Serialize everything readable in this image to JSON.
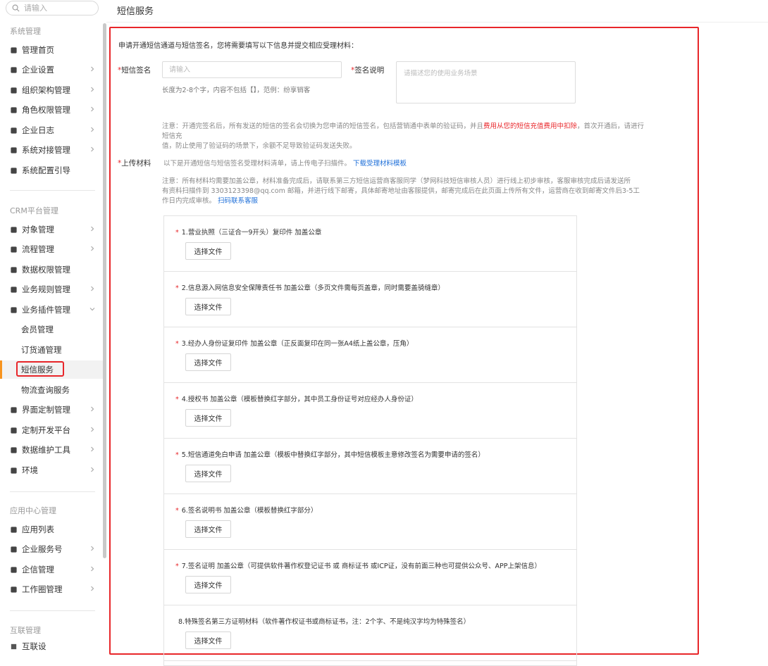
{
  "sidebar": {
    "search_placeholder": "请输入",
    "sections": [
      {
        "title": "系统管理"
      },
      {
        "title": "CRM平台管理"
      },
      {
        "title": "应用中心管理"
      },
      {
        "title": "互联管理"
      }
    ],
    "system_items": [
      {
        "label": "管理首页",
        "icon": "home-icon"
      },
      {
        "label": "企业设置",
        "icon": "building-icon"
      },
      {
        "label": "组织架构管理",
        "icon": "org-chart-icon"
      },
      {
        "label": "角色权限管理",
        "icon": "id-card-icon"
      },
      {
        "label": "企业日志",
        "icon": "log-icon"
      },
      {
        "label": "系统对接管理",
        "icon": "link-icon"
      },
      {
        "label": "系统配置引导",
        "icon": "config-icon"
      }
    ],
    "crm_items": [
      {
        "label": "对象管理",
        "icon": "user-object-icon"
      },
      {
        "label": "流程管理",
        "icon": "flow-icon"
      },
      {
        "label": "数据权限管理",
        "icon": "lock-icon"
      },
      {
        "label": "业务规则管理",
        "icon": "wrench-icon"
      },
      {
        "label": "业务插件管理",
        "icon": "puzzle-icon"
      }
    ],
    "plugin_sub_items": [
      {
        "label": "会员管理"
      },
      {
        "label": "订货通管理"
      },
      {
        "label": "短信服务"
      },
      {
        "label": "物流查询服务"
      }
    ],
    "crm_items_after": [
      {
        "label": "界面定制管理",
        "icon": "palette-icon"
      },
      {
        "label": "定制开发平台",
        "icon": "monitor-icon"
      },
      {
        "label": "数据维护工具",
        "icon": "database-icon"
      },
      {
        "label": "环境",
        "icon": "pulse-icon"
      }
    ],
    "app_items": [
      {
        "label": "应用列表",
        "icon": "grid-icon"
      },
      {
        "label": "企业服务号",
        "icon": "desktop-icon"
      },
      {
        "label": "企信管理",
        "icon": "chat-icon"
      },
      {
        "label": "工作圈管理",
        "icon": "edit-icon"
      }
    ],
    "partial_item": {
      "label": "互联设"
    }
  },
  "page": {
    "title": "短信服务",
    "intro": "申请开通短信通道与短信签名，您将需要填写以下信息并提交相应受理材料：",
    "signature": {
      "label": "短信签名",
      "placeholder": "请输入",
      "hint": "长度为2-8个字，内容不包括【】，范例：纷享销客"
    },
    "signature_desc": {
      "label": "签名说明",
      "placeholder": "请描述您的使用业务场景"
    },
    "notice_prefix": "注意：开通完签名后，所有发送的短信的签名会切换为您申请的短信签名，包括营销通中表单的验证码，并且",
    "notice_red": "费用从您的短信充值费用中扣除",
    "notice_suffix": "，首次开通后，请进行短信充",
    "notice_line2": "值，防止使用了验证码的场景下，余额不足导致验证码发送失败。",
    "upload": {
      "label": "上传材料",
      "hint": "以下是开通短信与短信签名受理材料清单，请上传电子扫描件。",
      "download_link": "下载受理材料模板",
      "note_line1": "注意：所有材料均需要加盖公章，材料准备完成后，请联系第三方短信运营商客服同学（梦网科技短信审核人员）进行线上初步审核，客服审核完成后请发送所",
      "note_line2": "有资料扫描件到 3303123398@qq.com 邮箱，并进行线下邮寄，具体邮寄地址由客服提供，邮寄完成后在此页面上传所有文件，运营商在收到邮寄文件后3-5工",
      "note_line3": "作日内完成审核。",
      "contact_link": "扫码联系客服",
      "button_label": "选择文件",
      "items": [
        {
          "title": "1.营业执照（三证合一9开头）复印件 加盖公章",
          "required": "*"
        },
        {
          "title": "2.信息源入网信息安全保障责任书 加盖公章（多页文件需每页盖章，同时需要盖骑缝章）",
          "required": "*"
        },
        {
          "title": "3.经办人身份证复印件 加盖公章（正反面复印在同一张A4纸上盖公章，压角）",
          "required": "*"
        },
        {
          "title": "4.授权书 加盖公章（模板替换红字部分，其中员工身份证号对应经办人身份证）",
          "required": "*"
        },
        {
          "title": "5.短信通道免白申请 加盖公章（模板中替换红字部分，其中短信模板主意修改签名为需要申请的签名）",
          "required": "*"
        },
        {
          "title": "6.签名说明书 加盖公章（模板替换红字部分）",
          "required": "*"
        },
        {
          "title": "7.签名证明 加盖公章（可提供软件著作权登记证书 或 商标证书 或ICP证，没有前面三种也可提供公众号、APP上架信息）",
          "required": "*"
        },
        {
          "title": "8.特殊签名第三方证明材料（软件著作权证书或商标证书，注：2个字、不是纯汉字均为特殊签名）",
          "required": ""
        }
      ]
    },
    "required_mark": "*"
  },
  "colors": {
    "accent_red": "#e8262a",
    "link_blue": "#1e6fd9",
    "active_bar": "#f7931e"
  }
}
